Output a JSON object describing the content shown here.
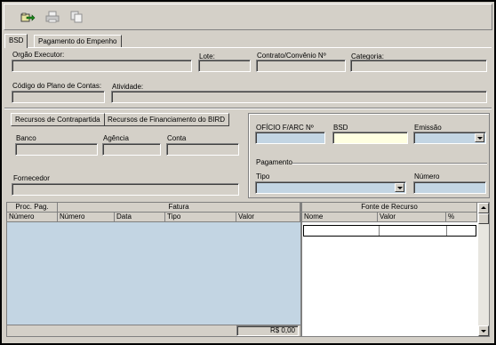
{
  "toolbar": {
    "buttons": [
      {
        "name": "enter-icon"
      },
      {
        "name": "print-icon"
      },
      {
        "name": "copy-icon"
      }
    ]
  },
  "tabs": [
    {
      "label": "BSD"
    },
    {
      "label": "Pagamento do Empenho"
    }
  ],
  "form": {
    "orgao_label": "Orgão Executor:",
    "lote_label": "Lote:",
    "contrato_label": "Contrato/Convênio  Nº",
    "categoria_label": "Categoria:",
    "codigo_label": "Código do Plano de Contas:",
    "atividade_label": "Atividade:"
  },
  "subtabs": [
    {
      "label": "Recursos de Contrapartida"
    },
    {
      "label": "Recursos de Financiamento do BIRD"
    }
  ],
  "bank": {
    "banco_label": "Banco",
    "agencia_label": "Agência",
    "conta_label": "Conta",
    "fornecedor_label": "Fornecedor"
  },
  "oficio": {
    "oficio_label": "OFÍCIO F/ARC Nº",
    "bsd_label": "BSD",
    "emissao_label": "Emissão"
  },
  "pagamento": {
    "group_label": "Pagamento",
    "tipo_label": "Tipo",
    "numero_label": "Número"
  },
  "left_grid": {
    "group_headers": [
      "Proc. Pag.",
      "Fatura"
    ],
    "columns": [
      "Número",
      "Número",
      "Data",
      "Tipo",
      "Valor"
    ],
    "total": "R$ 0,00"
  },
  "right_grid": {
    "title": "Fonte de Recurso",
    "columns": [
      "Nome",
      "Valor",
      "%"
    ]
  },
  "colors": {
    "window_bg": "#d4d0c8",
    "grid_blue": "#c3d5e3",
    "bsd_field": "#ffffe1"
  }
}
